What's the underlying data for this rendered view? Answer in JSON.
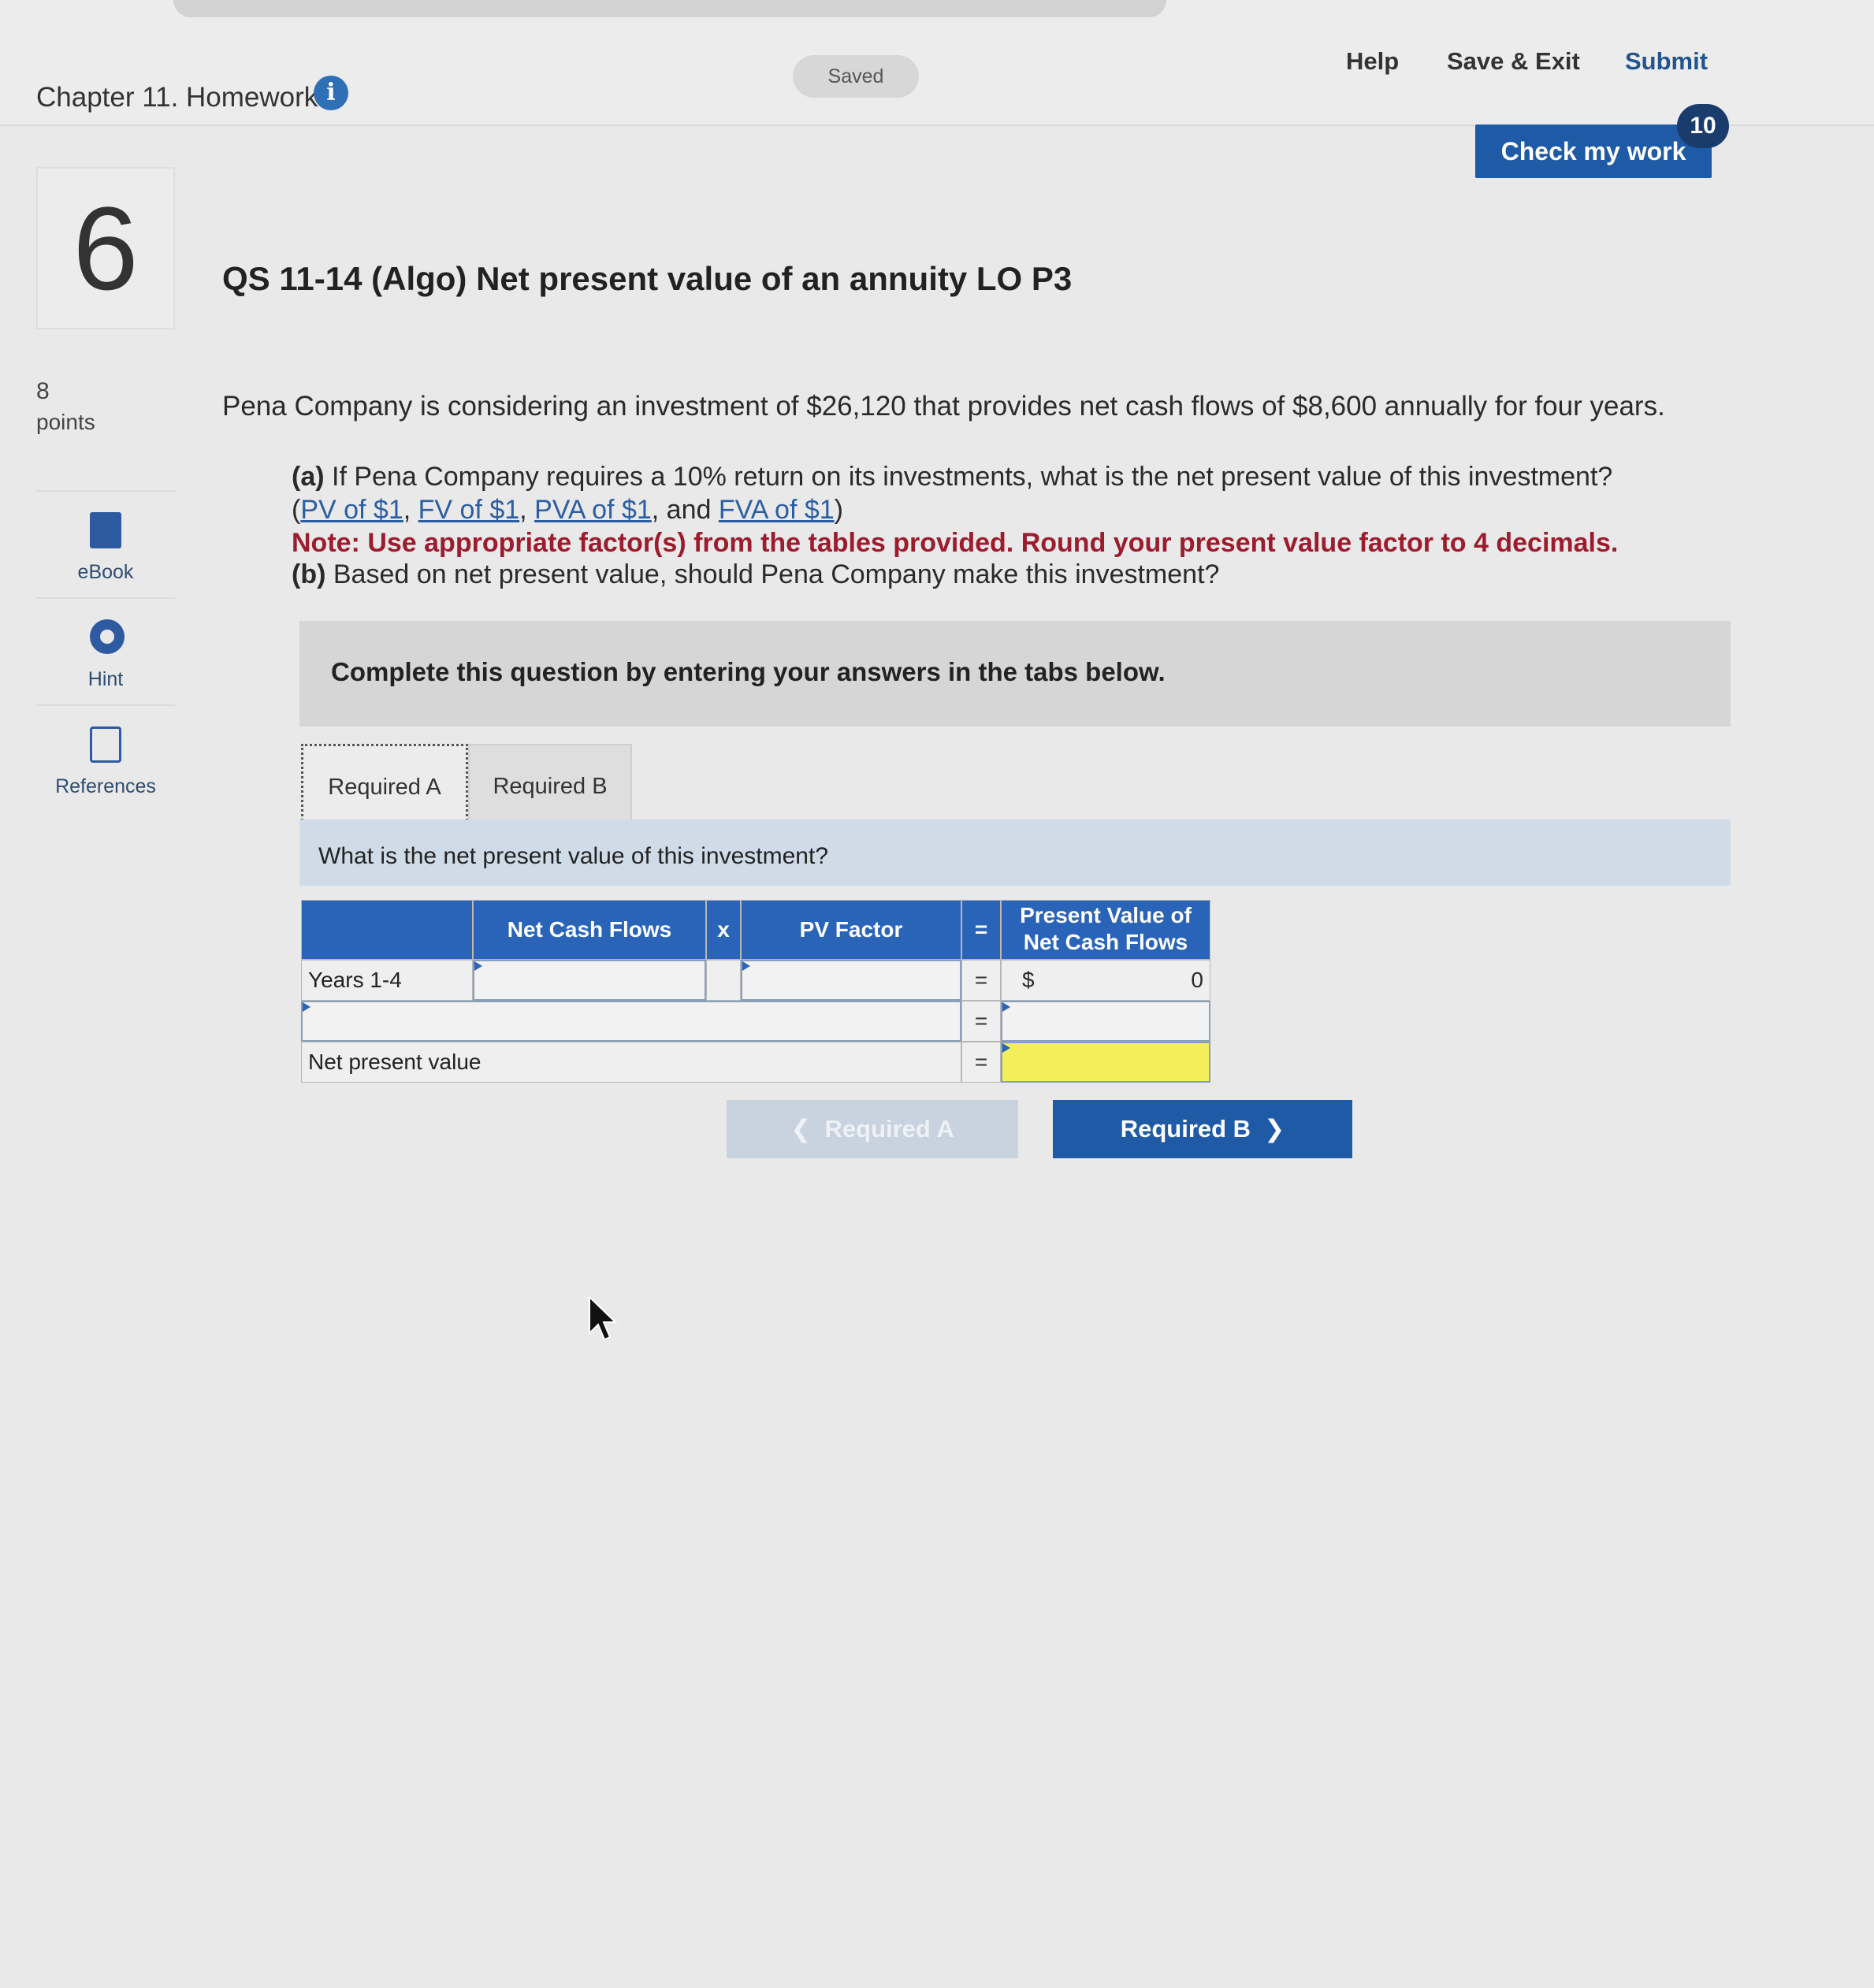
{
  "header": {
    "chapter_title": "Chapter 11. Homework",
    "saved_label": "Saved",
    "help_label": "Help",
    "save_exit_label": "Save & Exit",
    "submit_label": "Submit",
    "check_label": "Check my work",
    "check_badge": "10"
  },
  "sidebar": {
    "question_number": "6",
    "points_value": "8",
    "points_label": "points",
    "tools": [
      {
        "label": "eBook",
        "icon": "book-icon"
      },
      {
        "label": "Hint",
        "icon": "lifebuoy-icon"
      },
      {
        "label": "References",
        "icon": "copy-icon"
      }
    ]
  },
  "question": {
    "title": "QS 11-14 (Algo) Net present value of an annuity LO P3",
    "intro": "Pena Company is considering an investment of $26,120 that provides net cash flows of $8,600 annually for four years.",
    "part_a_prefix": "(a)",
    "part_a_text": " If Pena Company requires a 10% return on its investments, what is the net present value of this investment?",
    "links": [
      "PV of $1",
      "FV of $1",
      "PVA of $1",
      "FVA of $1"
    ],
    "note": "Note: Use appropriate factor(s) from the tables provided. Round your present value factor to 4 decimals.",
    "part_b_prefix": "(b)",
    "part_b_text": " Based on net present value, should Pena Company make this investment?",
    "instruction": "Complete this question by entering your answers in the tabs below."
  },
  "tabs": [
    {
      "label": "Required A",
      "active": true
    },
    {
      "label": "Required B",
      "active": false
    }
  ],
  "panel": {
    "prompt": "What is the net present value of this investment?",
    "table": {
      "headers": {
        "net_cash_flows": "Net Cash Flows",
        "times": "x",
        "pv_factor": "PV Factor",
        "equals": "=",
        "pv_line1": "Present Value of",
        "pv_line2": "Net Cash Flows"
      },
      "rows": [
        {
          "label": "Years 1-4",
          "net_cash_flows": "",
          "pv_factor": "",
          "eq": "=",
          "currency": "$",
          "value": "0"
        },
        {
          "label": "",
          "eq": "=",
          "value": ""
        },
        {
          "label": "Net present value",
          "eq": "=",
          "value": ""
        }
      ]
    }
  },
  "nav": {
    "prev_label": "Required A",
    "next_label": "Required B",
    "prev_icon": "chevron-left-icon",
    "next_icon": "chevron-right-icon"
  },
  "colors": {
    "accent": "#1e5aa6",
    "note_red": "#9c1c2e",
    "table_header": "#2a64b8",
    "highlight_yellow": "#f2ef5a"
  }
}
